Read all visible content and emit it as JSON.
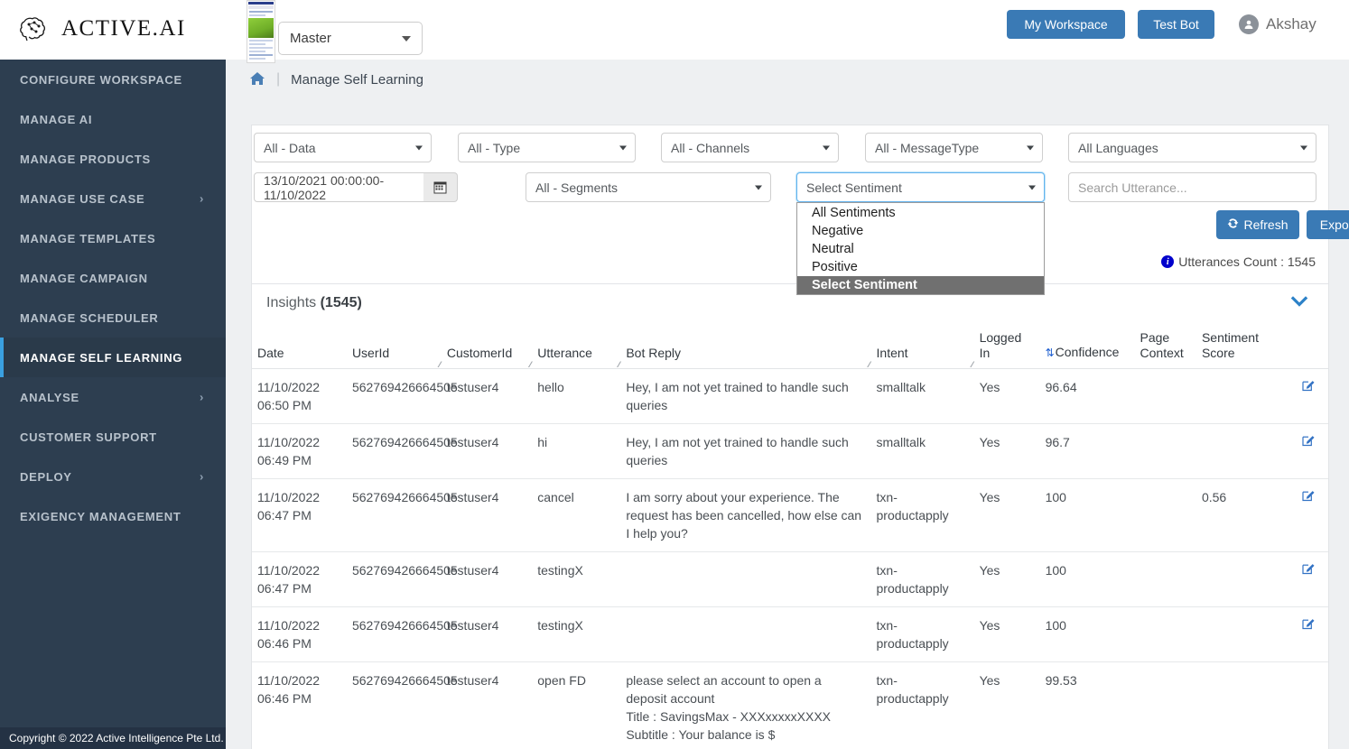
{
  "brand": {
    "name": "ACTIVE.AI",
    "logo_icon": "brain-network-icon"
  },
  "topbar": {
    "bot_selector_value": "Master",
    "my_workspace_label": "My Workspace",
    "test_bot_label": "Test Bot",
    "user_name": "Akshay",
    "avatar_icon": "user-avatar-icon",
    "accent_color": "#3a7ab5"
  },
  "sidebar": {
    "active_color": "#3aa0e0",
    "background": "#2d3e50",
    "items": [
      {
        "label": "CONFIGURE WORKSPACE",
        "has_chevron": false,
        "active": false
      },
      {
        "label": "MANAGE AI",
        "has_chevron": false,
        "active": false
      },
      {
        "label": "MANAGE PRODUCTS",
        "has_chevron": false,
        "active": false
      },
      {
        "label": "MANAGE USE CASE",
        "has_chevron": true,
        "active": false
      },
      {
        "label": "MANAGE TEMPLATES",
        "has_chevron": false,
        "active": false
      },
      {
        "label": "MANAGE CAMPAIGN",
        "has_chevron": false,
        "active": false
      },
      {
        "label": "MANAGE SCHEDULER",
        "has_chevron": false,
        "active": false
      },
      {
        "label": "MANAGE SELF LEARNING",
        "has_chevron": false,
        "active": true
      },
      {
        "label": "ANALYSE",
        "has_chevron": true,
        "active": false
      },
      {
        "label": "CUSTOMER SUPPORT",
        "has_chevron": false,
        "active": false
      },
      {
        "label": "DEPLOY",
        "has_chevron": true,
        "active": false
      },
      {
        "label": "EXIGENCY MANAGEMENT",
        "has_chevron": false,
        "active": false
      }
    ],
    "footer": "Copyright © 2022 Active Intelligence Pte Ltd."
  },
  "breadcrumb": {
    "home_icon": "home-icon",
    "separator": "|",
    "page": "Manage Self Learning"
  },
  "filters": {
    "data": "All - Data",
    "type": "All - Type",
    "channels": "All - Channels",
    "message_type": "All - MessageType",
    "languages": "All Languages",
    "date_range": "13/10/2021 00:00:00-11/10/2022",
    "calendar_icon": "calendar-icon",
    "segments": "All - Segments",
    "sentiment": "Select Sentiment",
    "search_placeholder": "Search Utterance...",
    "search_value": "",
    "sentiment_options": [
      {
        "label": "All Sentiments",
        "selected": false
      },
      {
        "label": "Negative",
        "selected": false
      },
      {
        "label": "Neutral",
        "selected": false
      },
      {
        "label": "Positive",
        "selected": false
      },
      {
        "label": "Select Sentiment",
        "selected": true
      }
    ],
    "refresh_label": "Refresh",
    "refresh_icon": "refresh-icon",
    "export_label": "Export",
    "utterances_count_label": "Utterances Count : 1545",
    "info_icon": "info-icon"
  },
  "insights": {
    "title": "Insights",
    "count": "(1545)",
    "collapse_icon": "chevron-down-icon",
    "columns": [
      {
        "label": "Date",
        "grip": false,
        "sort": false
      },
      {
        "label": "UserId",
        "grip": true,
        "sort": false
      },
      {
        "label": "CustomerId",
        "grip": true,
        "sort": false
      },
      {
        "label": "Utterance",
        "grip": true,
        "sort": false
      },
      {
        "label": "Bot Reply",
        "grip": true,
        "sort": false
      },
      {
        "label": "Intent",
        "grip": true,
        "sort": false
      },
      {
        "label": "Logged In",
        "grip": false,
        "sort": false
      },
      {
        "label": "Confidence",
        "grip": false,
        "sort": true
      },
      {
        "label": "Page Context",
        "grip": false,
        "sort": false
      },
      {
        "label": "Sentiment Score",
        "grip": false,
        "sort": false
      },
      {
        "label": "",
        "grip": false,
        "sort": false
      }
    ],
    "rows": [
      {
        "date": "11/10/2022 06:50 PM",
        "user_id": "562769426664505",
        "customer_id": "testuser4",
        "utterance": "hello",
        "bot_reply": "Hey, I am not yet trained to handle such queries",
        "intent": "smalltalk",
        "logged_in": "Yes",
        "confidence": "96.64",
        "page_context": "",
        "sentiment_score": "",
        "edit_icon": "edit-icon"
      },
      {
        "date": "11/10/2022 06:49 PM",
        "user_id": "562769426664505",
        "customer_id": "testuser4",
        "utterance": "hi",
        "bot_reply": "Hey, I am not yet trained to handle such queries",
        "intent": "smalltalk",
        "logged_in": "Yes",
        "confidence": "96.7",
        "page_context": "",
        "sentiment_score": "",
        "edit_icon": "edit-icon"
      },
      {
        "date": "11/10/2022 06:47 PM",
        "user_id": "562769426664505",
        "customer_id": "testuser4",
        "utterance": "cancel",
        "bot_reply": "I am sorry about your experience. The request has been cancelled, how else can I help you?",
        "intent": "txn-productapply",
        "logged_in": "Yes",
        "confidence": "100",
        "page_context": "",
        "sentiment_score": "0.56",
        "edit_icon": "edit-icon"
      },
      {
        "date": "11/10/2022 06:47 PM",
        "user_id": "562769426664505",
        "customer_id": "testuser4",
        "utterance": "testingX",
        "bot_reply": "",
        "intent": "txn-productapply",
        "logged_in": "Yes",
        "confidence": "100",
        "page_context": "",
        "sentiment_score": "",
        "edit_icon": "edit-icon"
      },
      {
        "date": "11/10/2022 06:46 PM",
        "user_id": "562769426664505",
        "customer_id": "testuser4",
        "utterance": "testingX",
        "bot_reply": "",
        "intent": "txn-productapply",
        "logged_in": "Yes",
        "confidence": "100",
        "page_context": "",
        "sentiment_score": "",
        "edit_icon": "edit-icon"
      },
      {
        "date": "11/10/2022 06:46 PM",
        "user_id": "562769426664505",
        "customer_id": "testuser4",
        "utterance": "open FD",
        "bot_reply": "please select an account to open a deposit account\nTitle : SavingsMax - XXXxxxxxXXXX\nSubtitle : Your balance is $",
        "intent": "txn-productapply",
        "logged_in": "Yes",
        "confidence": "99.53",
        "page_context": "",
        "sentiment_score": "",
        "edit_icon": ""
      }
    ]
  }
}
